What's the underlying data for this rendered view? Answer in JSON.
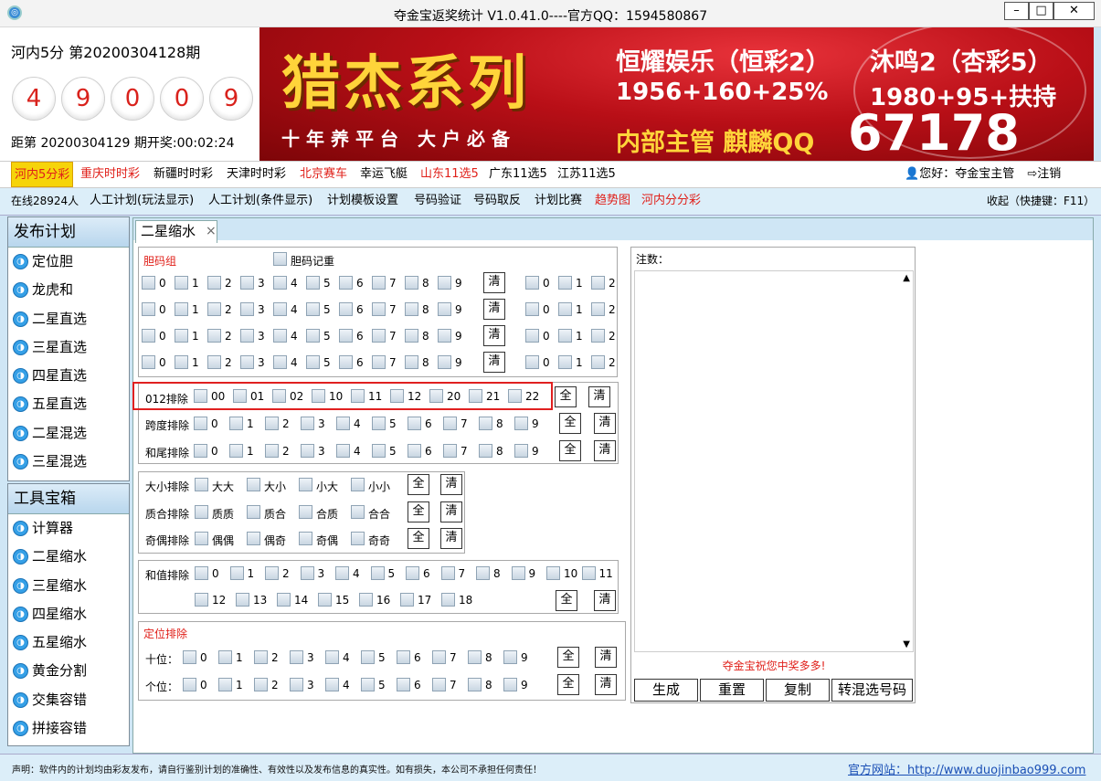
{
  "window": {
    "title": "夺金宝返奖统计  V1.0.41.0----官方QQ：1594580867",
    "min_glyph": "–",
    "max_glyph": "□",
    "close_glyph": "✕"
  },
  "lottery": {
    "name_period": "河内5分  第20200304128期",
    "balls": [
      "4",
      "9",
      "0",
      "0",
      "9"
    ],
    "countdown": "距第 20200304129 期开奖:00:02:24"
  },
  "banner": {
    "title": "猎杰系列",
    "slogan": "十年养平台 大户必备",
    "line1a": "恒耀娱乐（恒彩2）",
    "line1b": "沐鸣2（杏彩5）",
    "line2a": "1956+160+25%",
    "line2b": "1980+95+扶持",
    "line3a": "内部主管 麒麟QQ",
    "line3b": "67178"
  },
  "lottery_nav": {
    "items": [
      "河内5分彩",
      "重庆时时彩",
      "新疆时时彩",
      "天津时时彩",
      "北京赛车",
      "幸运飞艇",
      "山东11选5",
      "广东11选5",
      "江苏11选5"
    ],
    "user_greeting": "您好：夺金宝主管",
    "logout": "注销"
  },
  "toolbar": {
    "online": "在线28924人",
    "items": [
      "人工计划(玩法显示)",
      "人工计划(条件显示)",
      "计划模板设置",
      "号码验证",
      "号码取反",
      "计划比赛",
      "趋势图",
      "河内分分彩"
    ],
    "collapse": "收起（快捷键：F11）"
  },
  "sidebar_plan": {
    "title": "发布计划",
    "items": [
      "定位胆",
      "龙虎和",
      "二星直选",
      "三星直选",
      "四星直选",
      "五星直选",
      "二星混选",
      "三星混选"
    ]
  },
  "sidebar_tools": {
    "title": "工具宝箱",
    "items": [
      "计算器",
      "二星缩水",
      "三星缩水",
      "四星缩水",
      "五星缩水",
      "黄金分割",
      "交集容错",
      "拼接容错"
    ]
  },
  "tab": {
    "label": "二星缩水",
    "close": "×"
  },
  "form": {
    "btn_all": "全",
    "btn_clear": "清",
    "dan_group_label": "胆码组",
    "dan_repeat_label": "胆码记重",
    "digits": [
      "0",
      "1",
      "2",
      "3",
      "4",
      "5",
      "6",
      "7",
      "8",
      "9"
    ],
    "dan_right_digits": [
      "0",
      "1",
      "2"
    ],
    "exclude_012_label": "012排除",
    "exclude_012_options": [
      "00",
      "01",
      "02",
      "10",
      "11",
      "12",
      "20",
      "21",
      "22"
    ],
    "span_label": "跨度排除",
    "tail_label": "和尾排除",
    "size_label": "大小排除",
    "size_options": [
      "大大",
      "大小",
      "小大",
      "小小"
    ],
    "prime_label": "质合排除",
    "prime_options": [
      "质质",
      "质合",
      "合质",
      "合合"
    ],
    "odd_label": "奇偶排除",
    "odd_options": [
      "偶偶",
      "偶奇",
      "奇偶",
      "奇奇"
    ],
    "sum_label": "和值排除",
    "sum_options": [
      "0",
      "1",
      "2",
      "3",
      "4",
      "5",
      "6",
      "7",
      "8",
      "9",
      "10",
      "11",
      "12",
      "13",
      "14",
      "15",
      "16",
      "17",
      "18"
    ],
    "position_title": "定位排除",
    "tens_label": "十位：",
    "units_label": "个位："
  },
  "notes": {
    "label": "注数：",
    "scroll_up": "▲",
    "scroll_down": "▼",
    "message": "夺金宝祝您中奖多多!",
    "buttons": [
      "生成",
      "重置",
      "复制",
      "转混选号码"
    ]
  },
  "status": {
    "disclaimer": "声明：软件内的计划均由彩友发布，请自行鉴别计划的准确性、有效性以及发布信息的真实性。如有损失，本公司不承担任何责任！",
    "website": "官方网站：http://www.duojinbao999.com"
  },
  "colors": {
    "accent_red": "#e0201a",
    "nav_active": "#f6d40a",
    "banner_red": "#b90f17",
    "link_blue": "#1a4fb5"
  }
}
